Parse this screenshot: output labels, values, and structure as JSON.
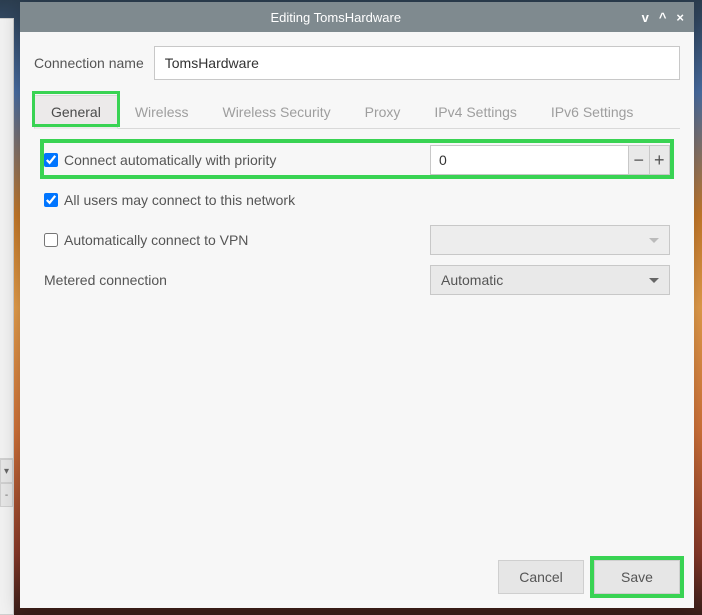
{
  "titlebar": {
    "title": "Editing TomsHardware"
  },
  "connection": {
    "label": "Connection name",
    "value": "TomsHardware"
  },
  "tabs": {
    "items": [
      {
        "label": "General"
      },
      {
        "label": "Wireless"
      },
      {
        "label": "Wireless Security"
      },
      {
        "label": "Proxy"
      },
      {
        "label": "IPv4 Settings"
      },
      {
        "label": "IPv6 Settings"
      }
    ],
    "activeIndex": 0
  },
  "general": {
    "auto_connect": {
      "label": "Connect automatically with priority",
      "checked": true,
      "priority": "0"
    },
    "all_users": {
      "label": "All users may connect to this network",
      "checked": true
    },
    "auto_vpn": {
      "label": "Automatically connect to VPN",
      "checked": false,
      "dropdown_value": ""
    },
    "metered": {
      "label": "Metered connection",
      "value": "Automatic"
    }
  },
  "footer": {
    "cancel": "Cancel",
    "save": "Save"
  },
  "icons": {
    "minus": "−",
    "plus": "+",
    "down": "v",
    "up": "^",
    "close": "×"
  }
}
